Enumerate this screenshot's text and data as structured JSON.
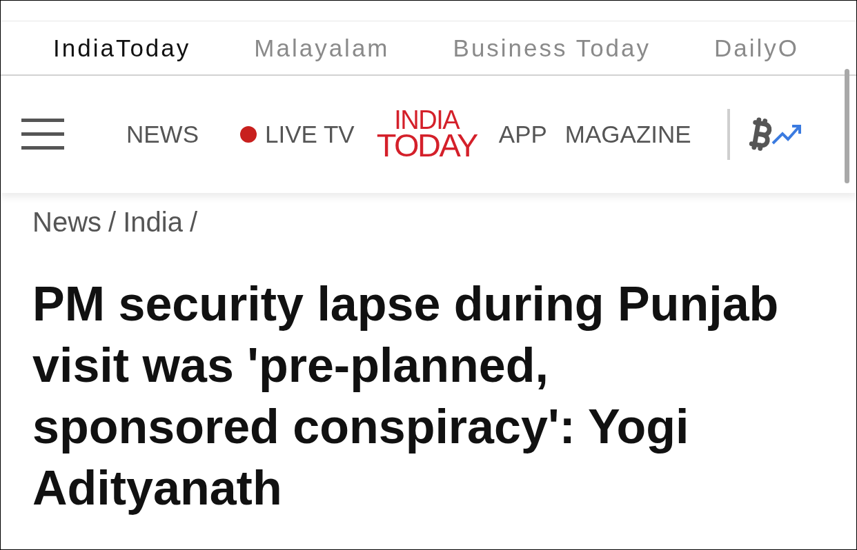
{
  "network_tabs": [
    {
      "label": "IndiaToday",
      "selected": true
    },
    {
      "label": "Malayalam",
      "selected": false
    },
    {
      "label": "Business Today",
      "selected": false
    },
    {
      "label": "DailyO",
      "selected": false
    }
  ],
  "header": {
    "nav_left": [
      {
        "label": "NEWS",
        "kind": "plain"
      },
      {
        "label": "LIVE TV",
        "kind": "live"
      }
    ],
    "logo": {
      "line_1": "INDIA",
      "line_2": "TODAY"
    },
    "nav_right": [
      {
        "label": "APP",
        "kind": "plain"
      },
      {
        "label": "MAGAZINE",
        "kind": "plain"
      }
    ]
  },
  "breadcrumb": [
    "News",
    "/",
    "India",
    "/"
  ],
  "headline": "PM security lapse during Punjab visit was 'pre-planned, sponsored conspiracy': Yogi Adityanath"
}
